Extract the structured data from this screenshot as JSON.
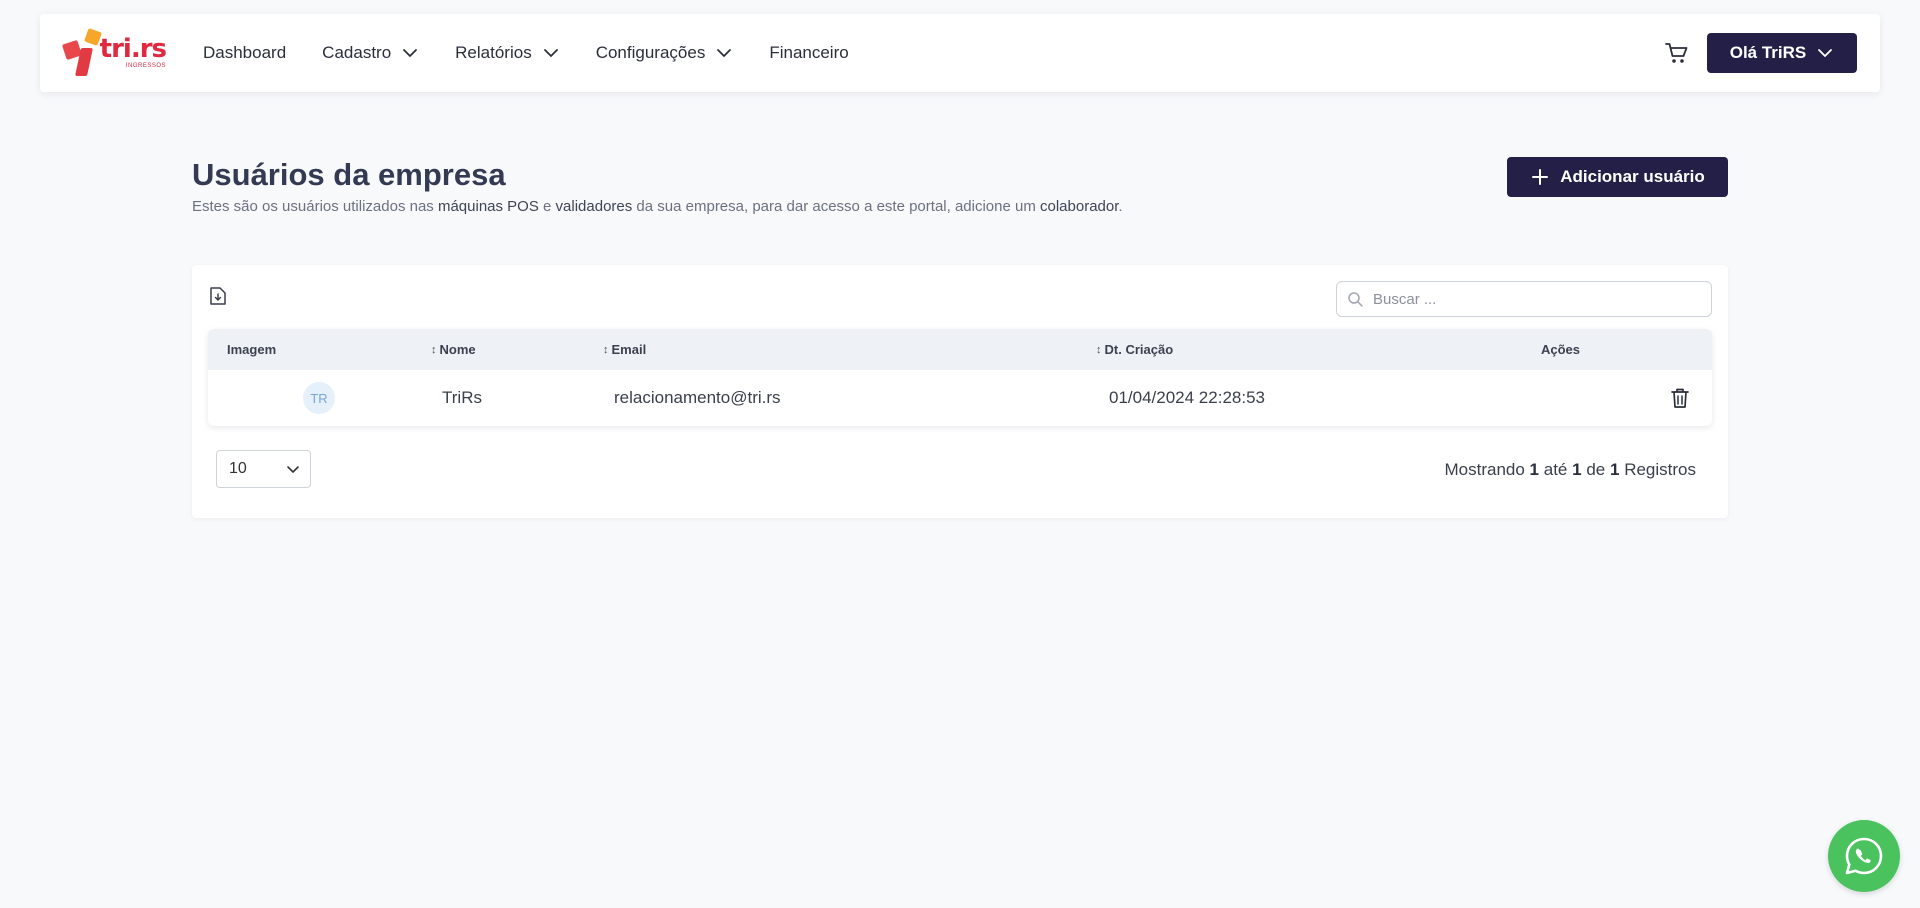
{
  "brand": {
    "logo_text": "tri.rs",
    "logo_sub": "INGRESSOS"
  },
  "nav": {
    "items": [
      {
        "label": "Dashboard",
        "dropdown": false
      },
      {
        "label": "Cadastro",
        "dropdown": true
      },
      {
        "label": "Relatórios",
        "dropdown": true
      },
      {
        "label": "Configurações",
        "dropdown": true
      },
      {
        "label": "Financeiro",
        "dropdown": false
      }
    ],
    "user_label": "Olá TriRS"
  },
  "page": {
    "title": "Usuários da empresa",
    "subtitle_parts": [
      "Estes são os usuários utilizados nas ",
      "máquinas POS",
      " e ",
      "validadores",
      " da sua empresa, para dar acesso a este portal, adicione um ",
      "colaborador",
      "."
    ],
    "add_button": "Adicionar usuário"
  },
  "search": {
    "placeholder": "Buscar ..."
  },
  "table": {
    "columns": [
      "Imagem",
      "Nome",
      "Email",
      "Dt. Criação",
      "Ações"
    ],
    "rows": [
      {
        "avatar": "TR",
        "name": "TriRs",
        "email": "relacionamento@tri.rs",
        "created": "01/04/2024 22:28:53"
      }
    ]
  },
  "pagination": {
    "page_size": "10",
    "showing_prefix": "Mostrando",
    "from": "1",
    "to_word": "até",
    "to": "1",
    "of_word": "de",
    "total": "1",
    "suffix": "Registros"
  },
  "colors": {
    "primary": "#231f47",
    "brand_red": "#e0283f",
    "whatsapp": "#4ac25e"
  }
}
